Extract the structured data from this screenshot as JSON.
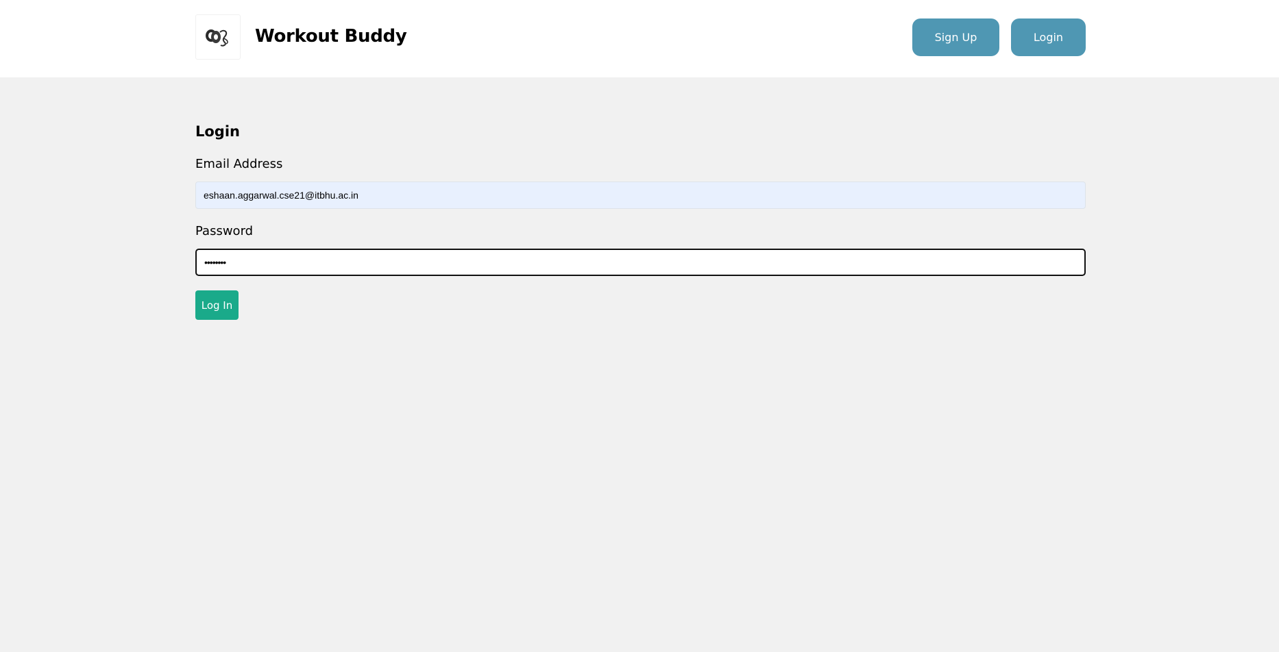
{
  "header": {
    "logo_icon": "dumbbell-logo-icon",
    "brand_title": "Workout Buddy",
    "nav": {
      "signup_label": "Sign Up",
      "login_label": "Login"
    }
  },
  "login_form": {
    "heading": "Login",
    "email": {
      "label": "Email Address",
      "value": "eshaan.aggarwal.cse21@itbhu.ac.in"
    },
    "password": {
      "label": "Password",
      "value": "••••••••"
    },
    "submit_label": "Log In"
  },
  "colors": {
    "nav_button": "#4f97b3",
    "submit_button": "#1aaa8a",
    "page_background": "#f1f1f1",
    "header_background": "#ffffff",
    "autofill_background": "#e8f0fe"
  }
}
